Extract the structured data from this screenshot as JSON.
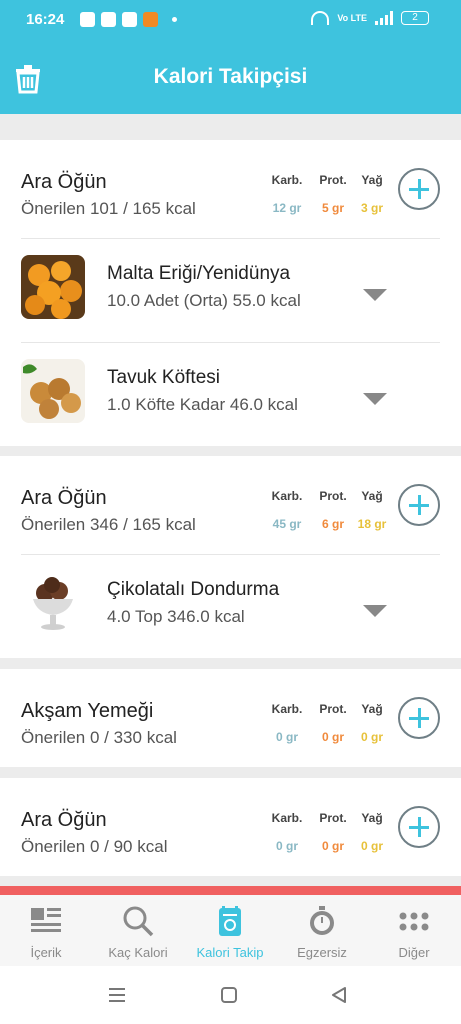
{
  "status": {
    "time": "16:24",
    "volte": "Vo LTE",
    "battery": "2"
  },
  "header": {
    "title": "Kalori Takipçisi"
  },
  "macro_labels": {
    "karb": "Karb.",
    "prot": "Prot.",
    "yag": "Yağ"
  },
  "meals": [
    {
      "name": "Ara Öğün",
      "recommended": "Önerilen 101 / 165 kcal",
      "karb": "12 gr",
      "prot": "5 gr",
      "yag": "3 gr",
      "foods": [
        {
          "name": "Malta Eriği/Yenidünya",
          "detail": "10.0 Adet (Orta) 55.0 kcal"
        },
        {
          "name": "Tavuk Köftesi",
          "detail": "1.0 Köfte Kadar 46.0 kcal"
        }
      ]
    },
    {
      "name": "Ara Öğün",
      "recommended": "Önerilen 346 / 165 kcal",
      "karb": "45 gr",
      "prot": "6 gr",
      "yag": "18 gr",
      "foods": [
        {
          "name": "Çikolatalı Dondurma",
          "detail": "4.0 Top 346.0 kcal"
        }
      ]
    },
    {
      "name": "Akşam Yemeği",
      "recommended": "Önerilen 0 / 330 kcal",
      "karb": "0 gr",
      "prot": "0 gr",
      "yag": "0 gr",
      "foods": []
    },
    {
      "name": "Ara Öğün",
      "recommended": "Önerilen 0 / 90 kcal",
      "karb": "0 gr",
      "prot": "0 gr",
      "yag": "0 gr",
      "foods": []
    }
  ],
  "nav": [
    {
      "label": "İçerik",
      "icon": "content-icon"
    },
    {
      "label": "Kaç Kalori",
      "icon": "search-icon"
    },
    {
      "label": "Kalori Takip",
      "icon": "tracker-icon"
    },
    {
      "label": "Egzersiz",
      "icon": "stopwatch-icon"
    },
    {
      "label": "Diğer",
      "icon": "more-icon"
    }
  ],
  "colors": {
    "accent": "#3ec3de",
    "karb": "#8ab8c4",
    "prot": "#f08a3c",
    "yag": "#e7c13a",
    "alert_line": "#f06060"
  }
}
